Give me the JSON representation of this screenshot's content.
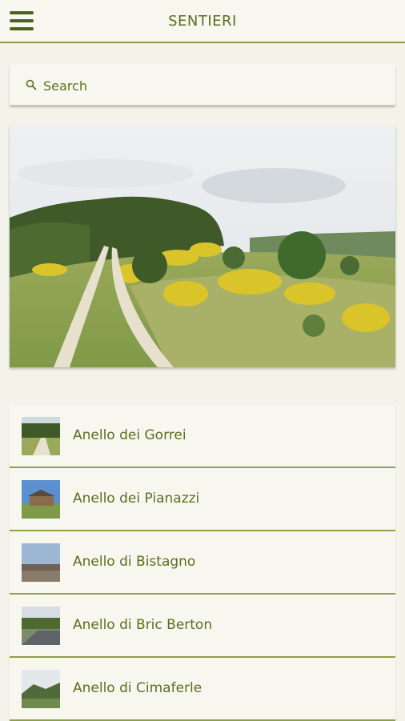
{
  "header": {
    "title": "SENTIERI",
    "menu_icon": "hamburger-menu-icon"
  },
  "search": {
    "placeholder": "Search",
    "value": "",
    "icon": "search-icon"
  },
  "trails": [
    {
      "label": "Anello dei Gorrei"
    },
    {
      "label": "Anello dei Pianazzi"
    },
    {
      "label": "Anello di Bistagno"
    },
    {
      "label": "Anello di Bric Berton"
    },
    {
      "label": "Anello di Cimaferle"
    }
  ],
  "colors": {
    "accent": "#5b6f1e",
    "divider": "#8fa04b",
    "background": "#f3f3ea"
  }
}
